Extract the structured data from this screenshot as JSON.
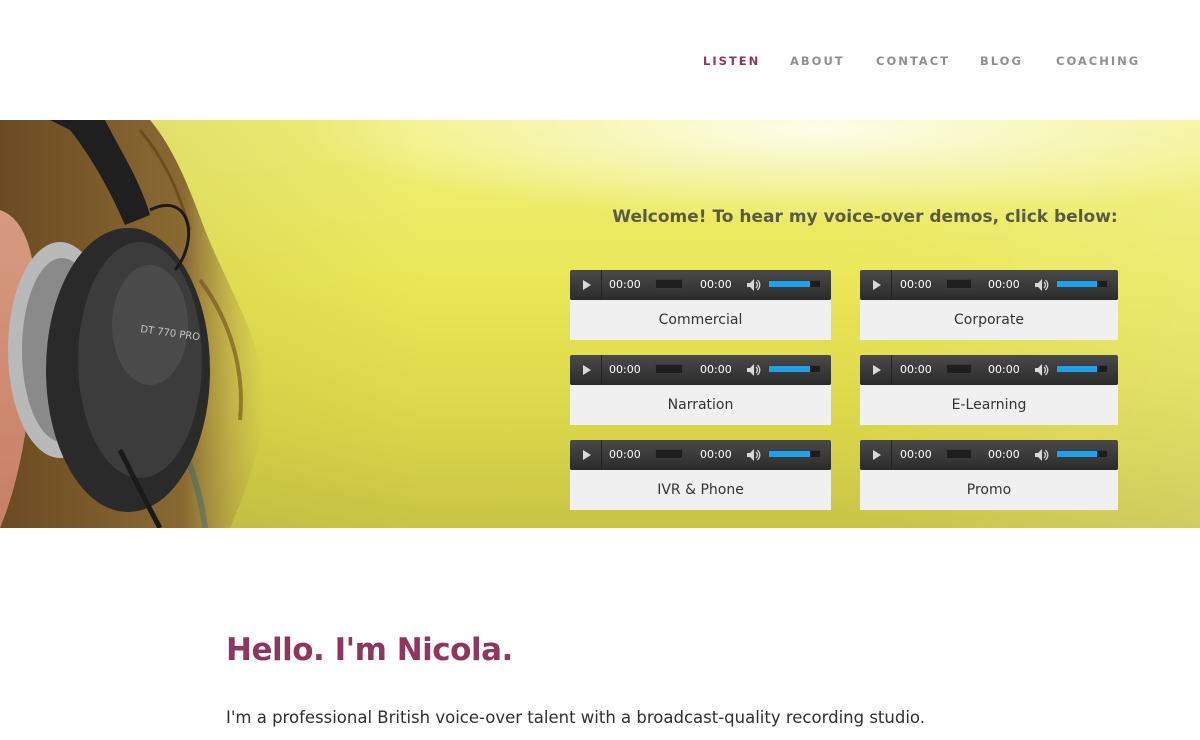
{
  "nav": {
    "items": [
      {
        "label": "LISTEN",
        "active": true
      },
      {
        "label": "ABOUT",
        "active": false
      },
      {
        "label": "CONTACT",
        "active": false
      },
      {
        "label": "BLOG",
        "active": false
      },
      {
        "label": "COACHING",
        "active": false
      }
    ]
  },
  "hero": {
    "welcome": "Welcome! To hear my voice-over demos, click below:",
    "players": [
      {
        "label": "Commercial",
        "current_time": "00:00",
        "duration": "00:00",
        "volume": 0.8
      },
      {
        "label": "Corporate",
        "current_time": "00:00",
        "duration": "00:00",
        "volume": 0.8
      },
      {
        "label": "Narration",
        "current_time": "00:00",
        "duration": "00:00",
        "volume": 0.8
      },
      {
        "label": "E-Learning",
        "current_time": "00:00",
        "duration": "00:00",
        "volume": 0.8
      },
      {
        "label": "IVR & Phone",
        "current_time": "00:00",
        "duration": "00:00",
        "volume": 0.8
      },
      {
        "label": "Promo",
        "current_time": "00:00",
        "duration": "00:00",
        "volume": 0.8
      }
    ]
  },
  "main": {
    "heading": "Hello. I'm Nicola.",
    "intro": "I'm a professional British voice-over talent with a broadcast-quality recording studio."
  },
  "colors": {
    "accent": "#8e3560",
    "nav_text": "#8f8f8f",
    "hero_yellow": "#e9e757",
    "volume_fill": "#1ea1e8"
  },
  "icons": {
    "play": "play-icon",
    "volume": "volume-icon"
  }
}
